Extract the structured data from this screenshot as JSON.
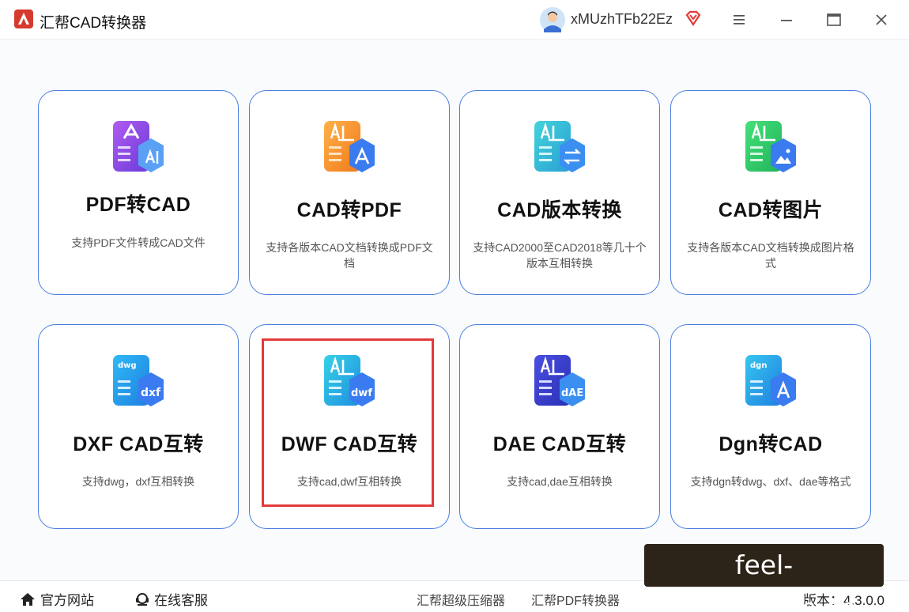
{
  "app": {
    "title": "汇帮CAD转换器",
    "username": "xMUzhTFb22Ez",
    "logo_icon": "app-logo-icon",
    "vip_icon": "vip-diamond-icon"
  },
  "cards": [
    {
      "title": "PDF转CAD",
      "desc": "支持PDF文件转成CAD文件",
      "icon": "pdf-to-cad-icon"
    },
    {
      "title": "CAD转PDF",
      "desc": "支持各版本CAD文档转换成PDF文档",
      "icon": "cad-to-pdf-icon"
    },
    {
      "title": "CAD版本转换",
      "desc": "支持CAD2000至CAD2018等几十个版本互相转换",
      "icon": "cad-version-icon"
    },
    {
      "title": "CAD转图片",
      "desc": "支持各版本CAD文档转换成图片格式",
      "icon": "cad-to-image-icon"
    },
    {
      "title": "DXF CAD互转",
      "desc": "支持dwg，dxf互相转换",
      "icon": "dxf-icon"
    },
    {
      "title": "DWF CAD互转",
      "desc": "支持cad,dwf互相转换",
      "icon": "dwf-icon"
    },
    {
      "title": "DAE CAD互转",
      "desc": "支持cad,dae互相转换",
      "icon": "dae-icon"
    },
    {
      "title": "Dgn转CAD",
      "desc": "支持dgn转dwg、dxf、dae等格式",
      "icon": "dgn-icon"
    }
  ],
  "footer": {
    "home_label": "官方网站",
    "service_label": "在线客服",
    "compressor_label": "汇帮超级压缩器",
    "pdf_converter_label": "汇帮PDF转换器",
    "version_label": "版本：4.3.0.0"
  },
  "watermark": {
    "text": "feel-sports.com.cn"
  },
  "colors": {
    "card_border": "#4a7fe0",
    "highlight": "#e23b3b",
    "watermark_bg": "#2c2418"
  }
}
